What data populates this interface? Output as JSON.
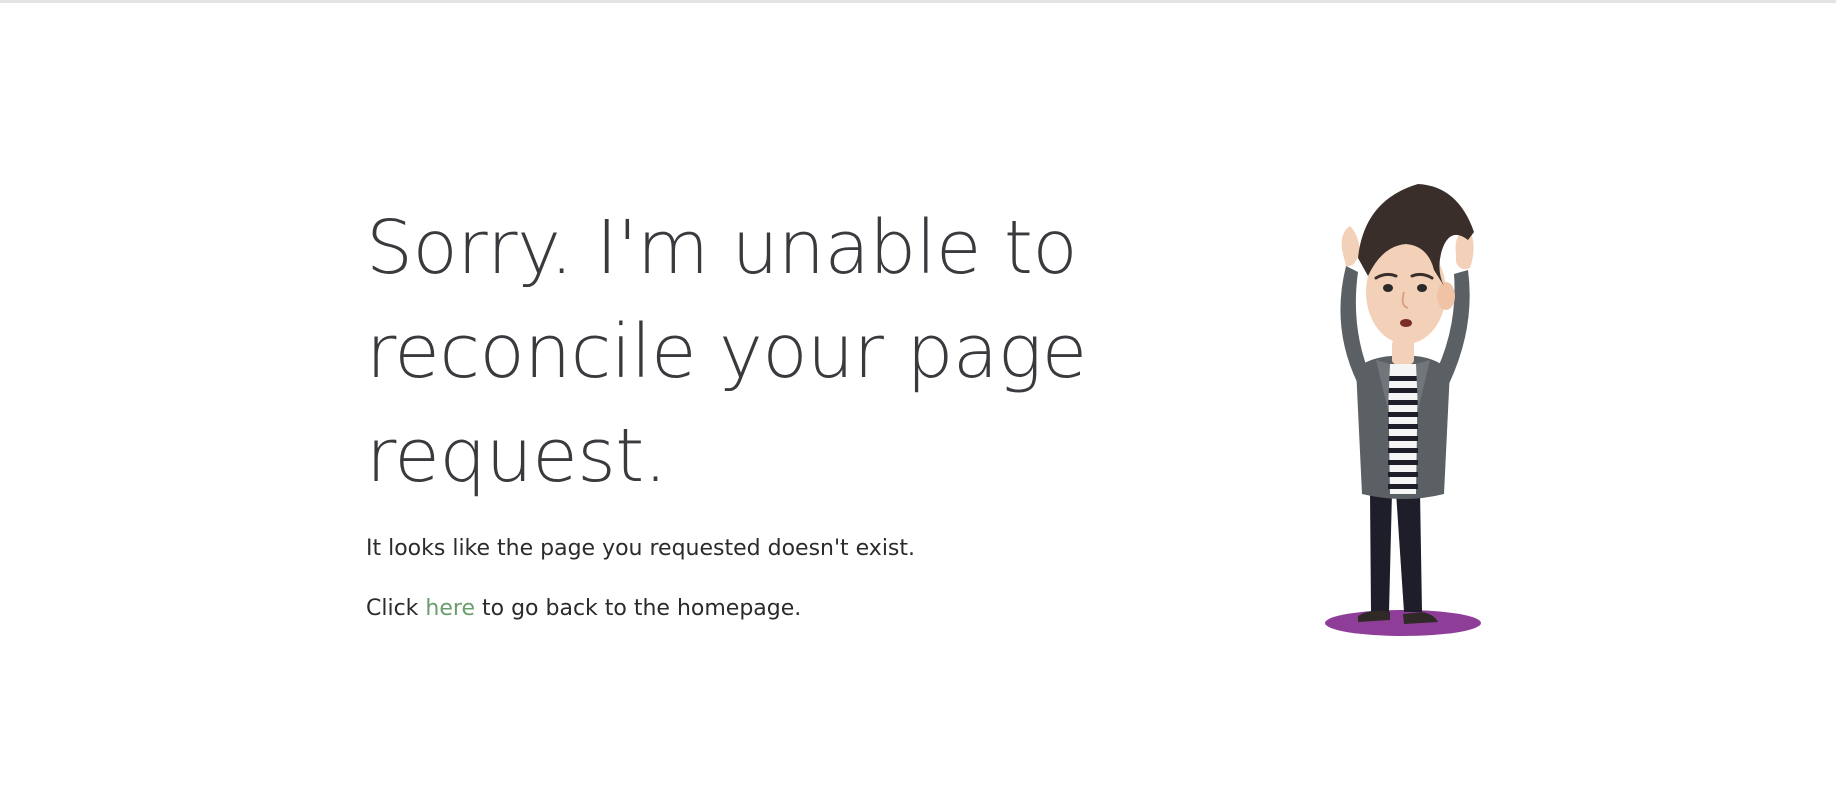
{
  "page": {
    "headline": "Sorry. I'm unable to reconcile your page request.",
    "subtext": "It looks like the page you requested doesn't exist.",
    "cta_prefix": "Click",
    "cta_link_label": "here",
    "cta_suffix": "to go back to the homepage."
  },
  "colors": {
    "text": "#393a3e",
    "link": "#6a9d6c",
    "shadow": "#8e3d99",
    "hair": "#3a2e2a",
    "jacket": "#5b6064"
  },
  "illustration": {
    "icon": "confused-man-illustration"
  }
}
